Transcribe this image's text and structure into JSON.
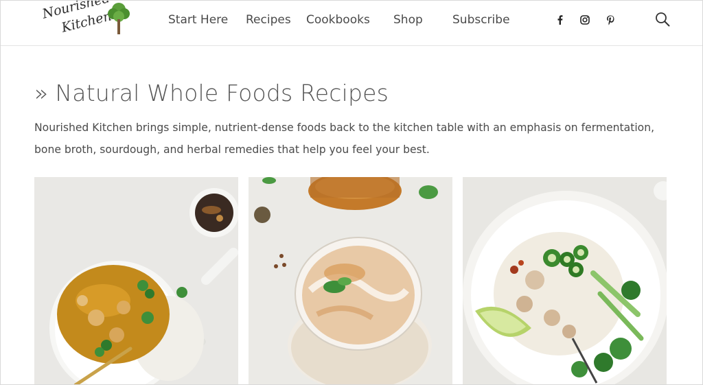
{
  "site": {
    "logo_line1": "Nourished",
    "logo_line2": "Kitchen"
  },
  "nav": {
    "items": [
      "Start Here",
      "Recipes",
      "Cookbooks",
      "Shop",
      "Subscribe"
    ]
  },
  "social": [
    "facebook-icon",
    "instagram-icon",
    "pinterest-icon"
  ],
  "page": {
    "chevron": "»",
    "title": "Natural Whole Foods Recipes",
    "intro": "Nourished Kitchen brings simple, nutrient-dense foods back to the kitchen table with an emphasis on fermentation, bone broth, sourdough, and herbal remedies that help you feel your best."
  },
  "cards": [
    {
      "image": "curry-with-rice-photo"
    },
    {
      "image": "herbal-drink-photo"
    },
    {
      "image": "rice-bowl-with-peppers-photo"
    }
  ],
  "colors": {
    "text": "#4a4a4a",
    "title": "#555555",
    "border": "#e3e3e3",
    "leaf_green": "#3e8f3a"
  }
}
